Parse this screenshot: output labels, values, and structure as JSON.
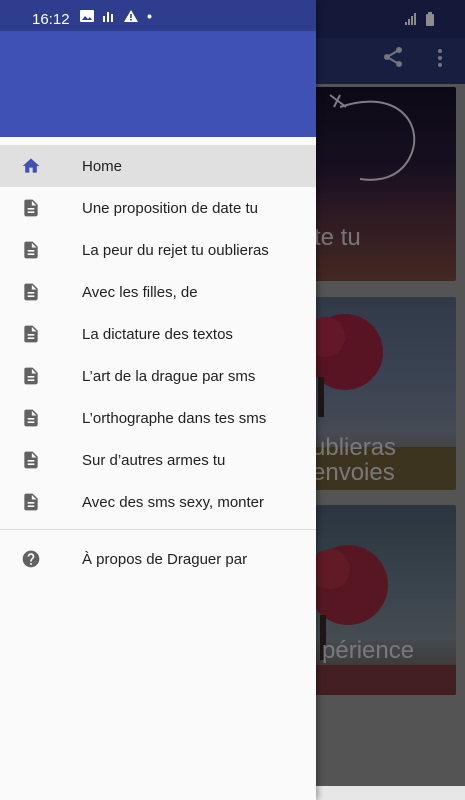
{
  "status": {
    "time": "16:12"
  },
  "background": {
    "cards": [
      {
        "title": "te tu"
      },
      {
        "title_line1": "ublieras",
        "title_line2": "envoies"
      },
      {
        "title": "périence"
      }
    ]
  },
  "drawer": {
    "items": [
      {
        "label": "Home",
        "icon": "home-icon",
        "active": true
      },
      {
        "label": "Une proposition de date tu",
        "icon": "document-icon"
      },
      {
        "label": "La peur du rejet tu oublieras",
        "icon": "document-icon"
      },
      {
        "label": "Avec les filles, de",
        "icon": "document-icon"
      },
      {
        "label": "La dictature des textos",
        "icon": "document-icon"
      },
      {
        "label": "L’art de la drague par sms",
        "icon": "document-icon"
      },
      {
        "label": "L’orthographe dans tes sms",
        "icon": "document-icon"
      },
      {
        "label": "Sur d’autres armes tu",
        "icon": "document-icon"
      },
      {
        "label": "Avec des sms sexy, monter",
        "icon": "document-icon"
      }
    ],
    "about": {
      "label": "À propos de Draguer par",
      "icon": "help-icon"
    }
  },
  "colors": {
    "primary": "#3f51b5",
    "primary_dark": "#2f3d8f",
    "active_icon": "#3f51b5",
    "item_icon": "#616161"
  }
}
